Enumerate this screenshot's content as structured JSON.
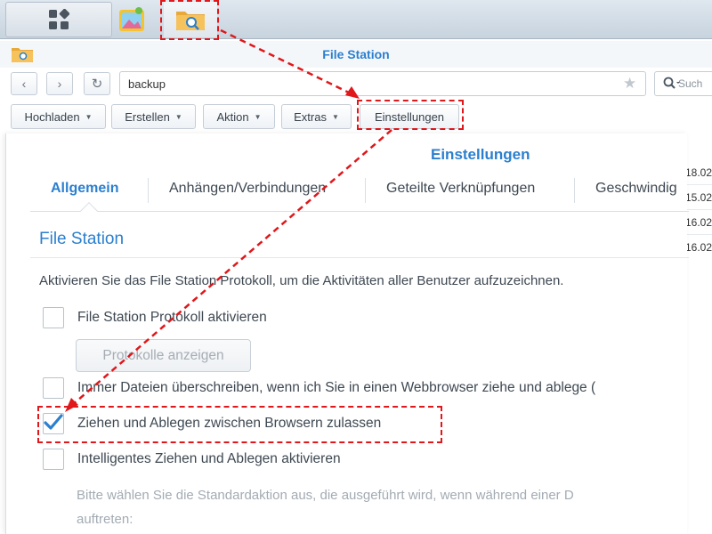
{
  "window": {
    "title": "File Station"
  },
  "address": {
    "path": "backup",
    "search_placeholder": "Such"
  },
  "toolbar": {
    "upload": "Hochladen",
    "create": "Erstellen",
    "action": "Aktion",
    "extras": "Extras",
    "settings": "Einstellungen"
  },
  "dialog": {
    "title": "Einstellungen",
    "tabs": [
      "Allgemein",
      "Anhängen/Verbindungen",
      "Geteilte Verknüpfungen",
      "Geschwindig"
    ],
    "section_title": "File Station",
    "description": "Aktivieren Sie das File Station Protokoll, um die Aktivitäten aller Benutzer aufzuzeichnen.",
    "options": [
      {
        "label": "File Station Protokoll aktivieren",
        "checked": false
      },
      {
        "label": "Immer Dateien überschreiben, wenn ich Sie in einen Webbrowser ziehe und ablege (",
        "checked": false
      },
      {
        "label": "Ziehen und Ablegen zwischen Browsern zulassen",
        "checked": true
      },
      {
        "label": "Intelligentes Ziehen und Ablegen aktivieren",
        "checked": false
      }
    ],
    "view_logs_button": "Protokolle anzeigen",
    "hint_line1": "Bitte wählen Sie die Standardaktion aus, die ausgeführt wird, wenn während einer D",
    "hint_line2": "auftreten:"
  },
  "background_dates": [
    "18.02",
    "15.02",
    "16.02",
    "16.02"
  ],
  "colors": {
    "accent": "#2b7fcf",
    "annotation": "#e0171b",
    "check": "#2b7fcf"
  }
}
